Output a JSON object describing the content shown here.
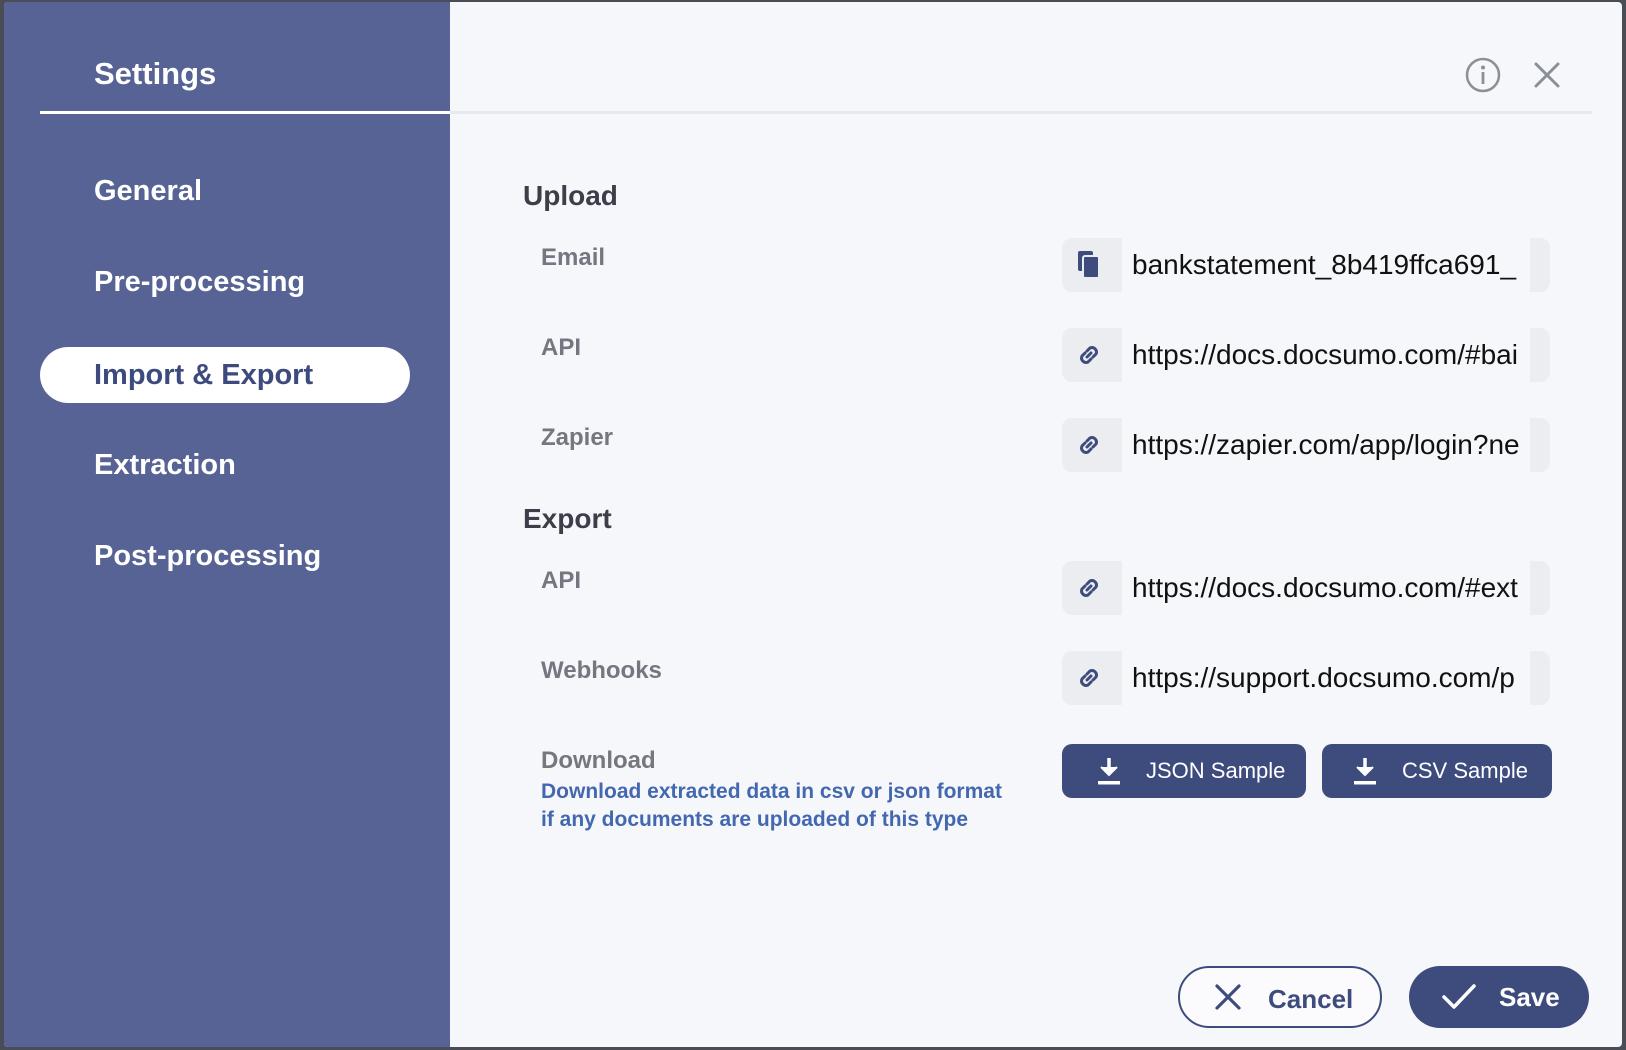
{
  "sidebar": {
    "title": "Settings",
    "items": [
      {
        "label": "General"
      },
      {
        "label": "Pre-processing"
      },
      {
        "label": "Import & Export"
      },
      {
        "label": "Extraction"
      },
      {
        "label": "Post-processing"
      }
    ],
    "active": "Import & Export"
  },
  "header_icons": [
    "info-icon",
    "close-icon"
  ],
  "upload": {
    "title": "Upload",
    "rows": [
      {
        "label": "Email",
        "icon": "copy-icon",
        "value": "bankstatement_8b419ffca691_"
      },
      {
        "label": "API",
        "icon": "link-icon",
        "value": "https://docs.docsumo.com/#bai"
      },
      {
        "label": "Zapier",
        "icon": "link-icon",
        "value": "https://zapier.com/app/login?ne"
      }
    ]
  },
  "export": {
    "title": "Export",
    "rows": [
      {
        "label": "API",
        "icon": "link-icon",
        "value": "https://docs.docsumo.com/#ext"
      },
      {
        "label": "Webhooks",
        "icon": "link-icon",
        "value": "https://support.docsumo.com/p"
      }
    ],
    "download": {
      "label": "Download",
      "description": "Download extracted data in csv or json format if any documents are uploaded of this type",
      "json_button": "JSON Sample",
      "csv_button": "CSV Sample"
    }
  },
  "footer": {
    "cancel_label": "Cancel",
    "save_label": "Save"
  },
  "colors": {
    "sidebar_bg": "#566394",
    "accent": "#3e4b7d",
    "link_text": "#4468b0",
    "content_bg": "#f6f7fa"
  }
}
